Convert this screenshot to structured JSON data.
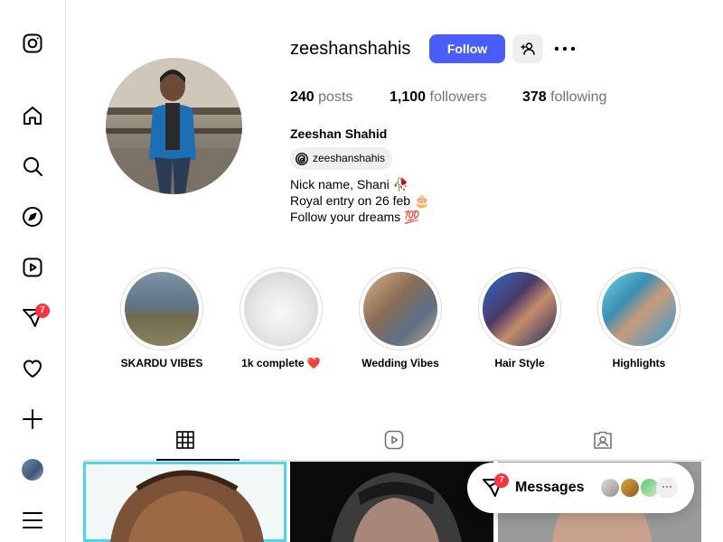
{
  "sidebar": {
    "items": [
      {
        "name": "instagram-logo-icon"
      },
      {
        "name": "home-icon"
      },
      {
        "name": "search-icon"
      },
      {
        "name": "explore-icon"
      },
      {
        "name": "reels-icon"
      },
      {
        "name": "messages-icon",
        "badge": "7"
      },
      {
        "name": "notifications-icon"
      },
      {
        "name": "create-icon"
      },
      {
        "name": "profile-avatar"
      },
      {
        "name": "more-menu-icon"
      }
    ],
    "messages_badge": "7"
  },
  "profile": {
    "username": "zeeshanshahis",
    "follow_label": "Follow",
    "posts_count": "240",
    "posts_label": "posts",
    "followers_count": "1,100",
    "followers_label": "followers",
    "following_count": "378",
    "following_label": "following",
    "full_name": "Zeeshan Shahid",
    "threads_handle": "zeeshanshahis",
    "bio": [
      "Nick name, Shani 🥀",
      "Royal entry on 26 feb 🎂",
      "Follow your dreams 💯"
    ]
  },
  "highlights": [
    {
      "label": "SKARDU VIBES"
    },
    {
      "label": "1k complete ❤️"
    },
    {
      "label": "Wedding Vibes"
    },
    {
      "label": "Hair Style"
    },
    {
      "label": "Highlights"
    }
  ],
  "tabs": [
    "posts-tab",
    "reels-tab",
    "tagged-tab"
  ],
  "messages_bar": {
    "label": "Messages",
    "badge": "7",
    "more": "···"
  },
  "colors": {
    "accent": "#4a5df9",
    "badge": "#ff3040",
    "divider": "#dbdbdb",
    "muted_text": "#737373"
  }
}
